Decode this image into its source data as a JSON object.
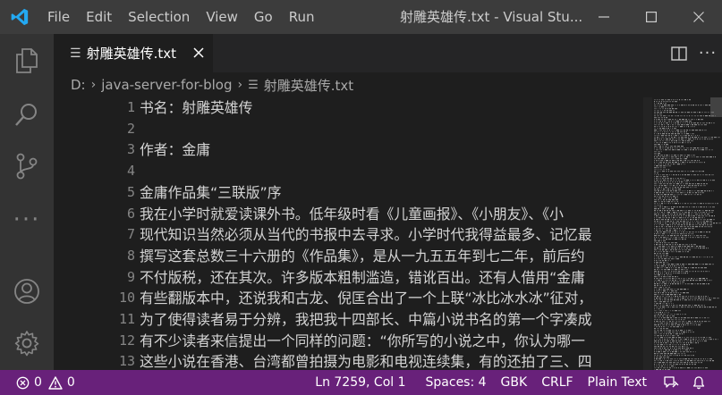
{
  "window": {
    "title": "射雕英雄传.txt - Visual Stu..."
  },
  "menu": {
    "items": [
      "File",
      "Edit",
      "Selection",
      "View",
      "Go",
      "Run"
    ]
  },
  "tabs": [
    {
      "label": "射雕英雄传.txt",
      "icon": "lines-icon",
      "active": true
    }
  ],
  "breadcrumb": {
    "drive": "D:",
    "folder": "java-server-for-blog",
    "file": "射雕英雄传.txt"
  },
  "editor": {
    "lines": [
      {
        "num": "1",
        "text": "书名：射雕英雄传"
      },
      {
        "num": "2",
        "text": ""
      },
      {
        "num": "3",
        "text": "作者：金庸"
      },
      {
        "num": "4",
        "text": ""
      },
      {
        "num": "5",
        "text": "金庸作品集“三联版”序"
      },
      {
        "num": "6",
        "text": "我在小学时就爱读课外书。低年级时看《儿童画报》、《小朋友》、《小"
      },
      {
        "num": "7",
        "text": "现代知识当然必须从当代的书报中去寻求。小学时代我得益最多、记忆最"
      },
      {
        "num": "8",
        "text": "撰写这套总数三十六册的《作品集》，是从一九五五年到七二年，前后约"
      },
      {
        "num": "9",
        "text": "不付版税，还在其次。许多版本粗制滥造，错讹百出。还有人借用“金庸"
      },
      {
        "num": "10",
        "text": "有些翻版本中，还说我和古龙、倪匡合出了一个上联“冰比冰水冰”征对，"
      },
      {
        "num": "11",
        "text": "为了使得读者易于分辨，我把我十四部长、中篇小说书名的第一个字凑成"
      },
      {
        "num": "12",
        "text": "有不少读者来信提出一个同样的问题：“你所写的小说之中，你认为哪一"
      },
      {
        "num": "13",
        "text": "这些小说在香港、台湾都曾拍摄为电影和电视连续集，有的还拍了三、四"
      }
    ]
  },
  "statusbar": {
    "errors": "0",
    "warnings": "0",
    "position": "Ln 7259, Col 1",
    "spaces": "Spaces: 4",
    "encoding": "GBK",
    "eol": "CRLF",
    "language": "Plain Text"
  },
  "colors": {
    "titlebar": "#3c3c3c",
    "activitybar": "#333333",
    "editor_bg": "#1e1e1e",
    "statusbar": "#68217a",
    "logo_blue": "#23a9f2"
  }
}
